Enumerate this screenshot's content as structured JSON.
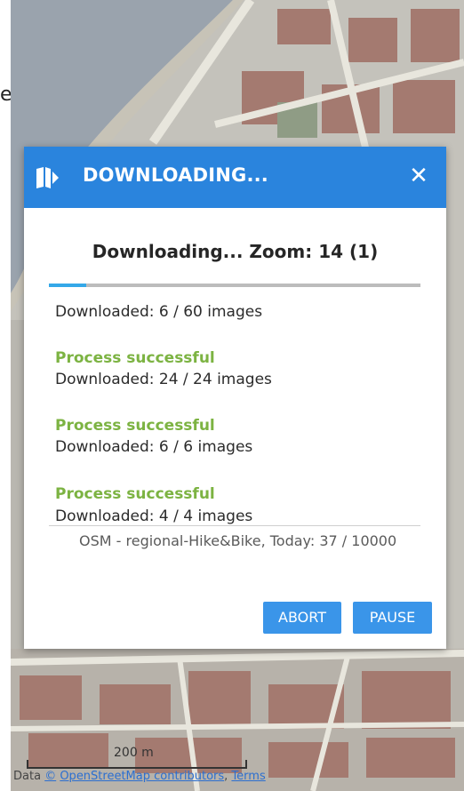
{
  "stray_text": "e",
  "dialog": {
    "title": "DOWNLOADING...",
    "zoom_status": "Downloading... Zoom: 14 (1)",
    "progress_fraction": 0.1,
    "current_status": "Downloaded: 6 / 60 images",
    "results": [
      {
        "status": "Process successful",
        "detail": "Downloaded: 24 / 24 images"
      },
      {
        "status": "Process successful",
        "detail": "Downloaded: 6 / 6 images"
      },
      {
        "status": "Process successful",
        "detail": "Downloaded: 4 / 4 images"
      }
    ],
    "footer_info": "OSM - regional-Hike&Bike, Today: 37 / 10000",
    "buttons": {
      "abort": "ABORT",
      "pause": "PAUSE"
    }
  },
  "map": {
    "scale_label": "200 m",
    "attribution_prefix": "Data ",
    "attribution_copyright": "©",
    "attribution_link": "OpenStreetMap contributors",
    "attribution_sep": ", ",
    "attribution_terms": "Terms"
  },
  "colors": {
    "header": "#2a84dd",
    "button": "#3a95e9",
    "success": "#7cb342",
    "progress": "#35a8e8"
  },
  "icons": {
    "header": "map-download-icon",
    "close": "close-icon"
  }
}
